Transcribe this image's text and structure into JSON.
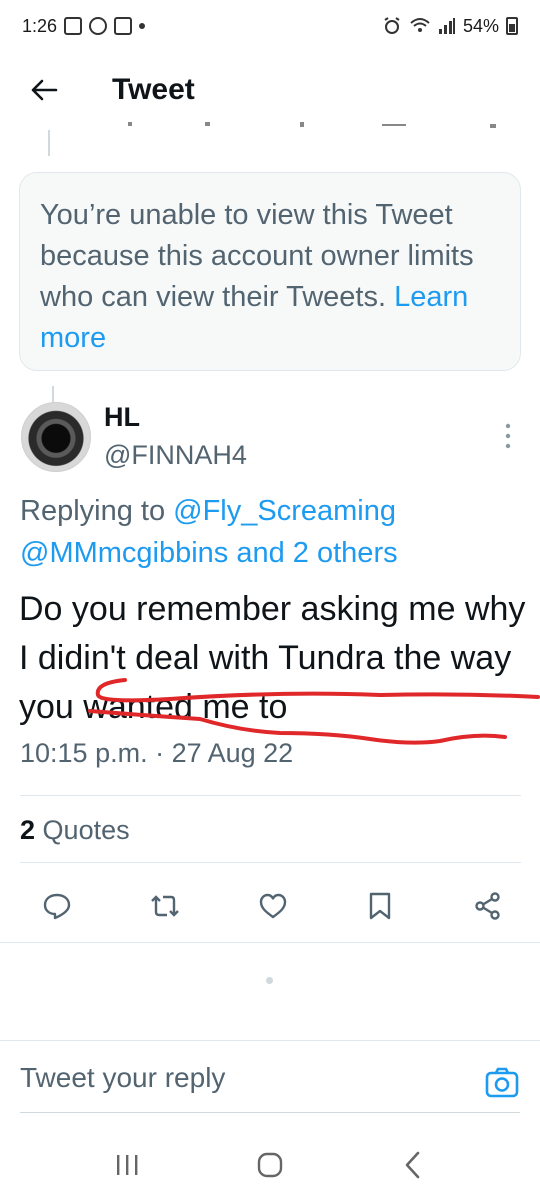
{
  "status_bar": {
    "time": "1:26",
    "battery": "54%"
  },
  "header": {
    "title": "Tweet"
  },
  "notice": {
    "message": "You’re unable to view this Tweet because this account owner limits who can view their Tweets.",
    "link": "Learn more"
  },
  "tweet": {
    "author_name": "HL",
    "author_handle": "@FINNAH4",
    "replying_prefix": "Replying to",
    "mention_1": "@Fly_Screaming",
    "mention_2": "@MMmcgibbins and 2 others",
    "text": "Do you remember asking me why I didin't deal with Tundra the  way you wanted me to",
    "timestamp": "10:15 p.m. · 27 Aug 22",
    "quotes_count": "2",
    "quotes_label": "Quotes",
    "annotation_color": "#e0282a"
  },
  "actions": {
    "icons": [
      "reply-icon",
      "retweet-icon",
      "like-icon",
      "bookmark-icon",
      "share-icon"
    ]
  },
  "reply_bar": {
    "placeholder": "Tweet your reply"
  },
  "colors": {
    "accent": "#1d9bf0",
    "text": "#0f1419",
    "secondary_text": "#536471"
  }
}
